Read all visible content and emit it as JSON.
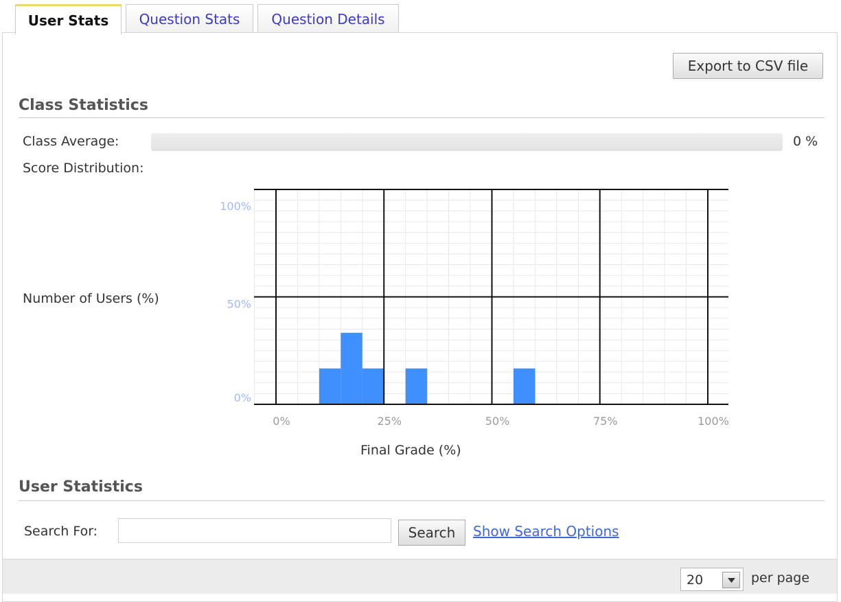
{
  "tabs": [
    {
      "label": "User Stats",
      "active": true
    },
    {
      "label": "Question Stats",
      "active": false
    },
    {
      "label": "Question Details",
      "active": false
    }
  ],
  "export_button": "Export to CSV file",
  "class_statistics": {
    "title": "Class Statistics",
    "average_label": "Class Average:",
    "average_value": "0 %",
    "average_fraction": 0,
    "distribution_label": "Score Distribution:"
  },
  "chart_data": {
    "type": "bar",
    "ylabel": "Number of Users (%)",
    "xlabel": "Final Grade (%)",
    "yticks": [
      "0%",
      "50%",
      "100%"
    ],
    "xticks": [
      "0%",
      "25%",
      "50%",
      "75%",
      "100%"
    ],
    "xlim": [
      0,
      100
    ],
    "ylim": [
      0,
      100
    ],
    "bin_width": 5,
    "bars": [
      {
        "x_start": 10,
        "x_end": 15,
        "value": 16.7
      },
      {
        "x_start": 15,
        "x_end": 20,
        "value": 33.3
      },
      {
        "x_start": 20,
        "x_end": 25,
        "value": 16.7
      },
      {
        "x_start": 30,
        "x_end": 35,
        "value": 16.7
      },
      {
        "x_start": 55,
        "x_end": 60,
        "value": 16.7
      }
    ],
    "grid": true,
    "bar_color": "#3f90ff"
  },
  "user_statistics": {
    "title": "User Statistics",
    "search_label": "Search For:",
    "search_value": "",
    "search_button": "Search",
    "search_options_link": "Show Search Options"
  },
  "pagination": {
    "per_page_value": "20",
    "per_page_label": "per page"
  }
}
